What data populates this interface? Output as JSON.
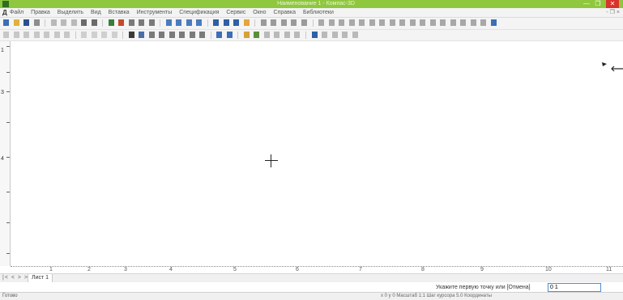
{
  "window": {
    "title": "Наименование 1 - Компас-3D",
    "minimize_glyph": "—",
    "restore_glyph": "❐",
    "close_glyph": "✕"
  },
  "menubar": {
    "app_mark": "Д",
    "items": [
      "Файл",
      "Правка",
      "Выделить",
      "Вид",
      "Вставка",
      "Инструменты",
      "Спецификация",
      "Сервис",
      "Окно",
      "Справка",
      "Библиотеки"
    ],
    "mdi_controls": "- ❐ ×"
  },
  "drawing": {
    "vruler_labels": [
      "1",
      "3",
      "4"
    ],
    "hruler_labels": [
      "1",
      "2",
      "3",
      "4",
      "5",
      "6",
      "7",
      "8",
      "9",
      "10",
      "11"
    ]
  },
  "page_tabs": {
    "nav_buttons": "|< < > >|",
    "active_tab": "Лист 1"
  },
  "command": {
    "prompt": "Укажите первую точку или [Отмена]",
    "value": "0 1"
  },
  "status": {
    "left_text": "Готово",
    "right_text": "x 0   y 0   Масштаб 1:1   Шаг курсора 5.0   Координаты"
  },
  "colors": {
    "titlebar": "#8fc73e",
    "close_button": "#d9332a",
    "cmd_focus": "#4a90d9"
  }
}
